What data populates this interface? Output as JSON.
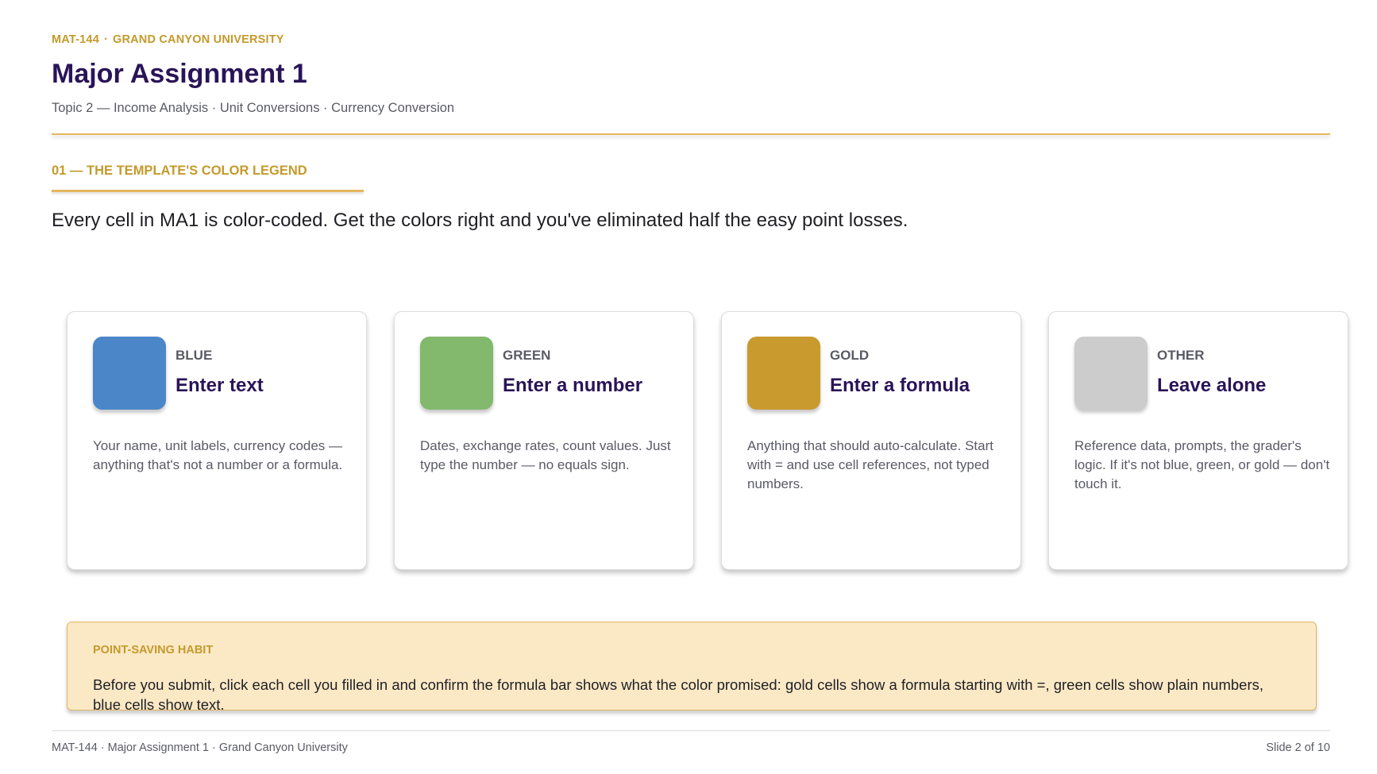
{
  "header": {
    "course": "MAT-144",
    "separator": "·",
    "university": "GRAND CANYON UNIVERSITY",
    "title": "Major Assignment 1",
    "subtitle": "Topic 2 — Income Analysis · Unit Conversions · Currency Conversion"
  },
  "section": {
    "label": "01 — THE TEMPLATE'S COLOR LEGEND",
    "lead": "Every cell in MA1 is color-coded. Get the colors right and you've eliminated half the easy point losses."
  },
  "cards": [
    {
      "kicker": "BLUE",
      "heading": "Enter text",
      "description": "Your name, unit labels, currency codes — anything that's not a number or a formula.",
      "color": "#4a86c8"
    },
    {
      "kicker": "GREEN",
      "heading": "Enter a number",
      "description": "Dates, exchange rates, count values. Just type the number — no equals sign.",
      "color": "#82b96d"
    },
    {
      "kicker": "GOLD",
      "heading": "Enter a formula",
      "description": "Anything that should auto-calculate. Start with = and use cell references, not typed numbers.",
      "color": "#c99a2e"
    },
    {
      "kicker": "OTHER",
      "heading": "Leave alone",
      "description": "Reference data, prompts, the grader's logic. If it's not blue, green, or gold — don't touch it.",
      "color": "#cccccc"
    }
  ],
  "habit": {
    "label": "POINT-SAVING HABIT",
    "text": "Before you submit, click each cell you filled in and confirm the formula bar shows what the color promised: gold cells show a formula starting with =, green cells show plain numbers, blue cells show text."
  },
  "footer": {
    "left": "MAT-144 · Major Assignment 1 · Grand Canyon University",
    "right": "Slide 2 of 10"
  }
}
